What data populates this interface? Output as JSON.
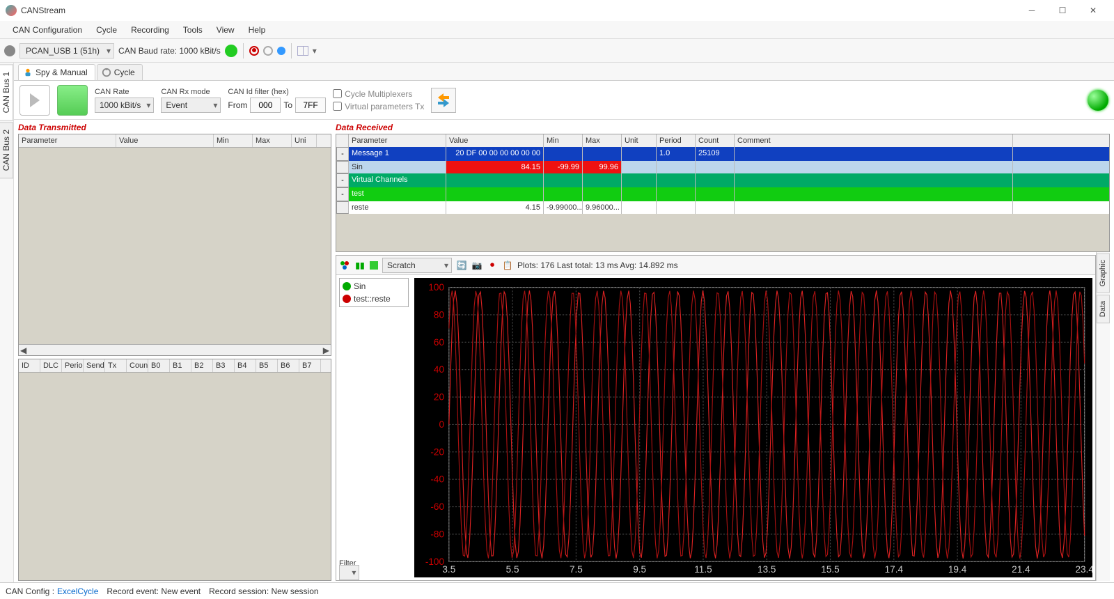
{
  "title": "CANStream",
  "menu": [
    "CAN Configuration",
    "Cycle",
    "Recording",
    "Tools",
    "View",
    "Help"
  ],
  "toolbar": {
    "device": "PCAN_USB 1 (51h)",
    "baud_label": "CAN Baud rate: 1000 kBit/s"
  },
  "vtabs": [
    "CAN Bus 1",
    "CAN Bus 2"
  ],
  "innertabs": {
    "spy": "Spy & Manual",
    "cycle": "Cycle"
  },
  "ctrl": {
    "can_rate_label": "CAN Rate",
    "can_rate": "1000 kBit/s",
    "rx_mode_label": "CAN Rx mode",
    "rx_mode": "Event",
    "id_filter_label": "CAN Id filter (hex)",
    "from_label": "From",
    "from": "000",
    "to_label": "To",
    "to": "7FF",
    "chk_mux": "Cycle Multiplexers",
    "chk_vtx": "Virtual parameters Tx"
  },
  "tx_label": "Data Transmitted",
  "tx_cols": [
    "Parameter",
    "Value",
    "Min",
    "Max",
    "Uni"
  ],
  "rx_label": "Data Received",
  "rx_cols": [
    "",
    "Parameter",
    "Value",
    "Min",
    "Max",
    "Unit",
    "Period",
    "Count",
    "Comment"
  ],
  "rx_rows": [
    {
      "cls": "blue",
      "toggle": "-",
      "cells": [
        "Message 1",
        "20 DF 00 00 00 00 00 00",
        "",
        "",
        "",
        "1.0",
        "25109",
        ""
      ]
    },
    {
      "cls": "ltblue",
      "toggle": "",
      "cells": [
        "Sin",
        "84.15",
        "-99.99",
        "99.96",
        "",
        "",
        "",
        ""
      ],
      "red": [
        1,
        2,
        3
      ]
    },
    {
      "cls": "green",
      "toggle": "-",
      "cells": [
        "Virtual Channels",
        "",
        "",
        "",
        "",
        "",
        "",
        ""
      ]
    },
    {
      "cls": "lgreen",
      "toggle": "-",
      "cells": [
        "test",
        "",
        "",
        "",
        "",
        "",
        "",
        ""
      ]
    },
    {
      "cls": "white",
      "toggle": "",
      "cells": [
        "reste",
        "4.15",
        "-9.99000...",
        "9.96000...",
        "",
        "",
        "",
        ""
      ]
    }
  ],
  "txgrid2_cols": [
    "ID",
    "DLC",
    "Perio",
    "Send",
    "Tx",
    "Coun",
    "B0",
    "B1",
    "B2",
    "B3",
    "B4",
    "B5",
    "B6",
    "B7"
  ],
  "graph": {
    "preset": "Scratch",
    "stats": "Plots: 176  Last total: 13 ms  Avg: 14.892 ms",
    "legend": [
      "Sin",
      "test::reste"
    ],
    "filter_label": "Filter",
    "rvtabs": [
      "Graphic",
      "Data"
    ],
    "yticks": [
      "100",
      "80",
      "60",
      "40",
      "20",
      "0",
      "-20",
      "-40",
      "-60",
      "-80",
      "-100"
    ],
    "xticks": [
      "3.5",
      "5.5",
      "7.5",
      "9.5",
      "11.5",
      "13.5",
      "15.5",
      "17.4",
      "19.4",
      "21.4",
      "23.4"
    ]
  },
  "chart_data": {
    "type": "line",
    "title": "",
    "xlabel": "",
    "ylabel": "",
    "xlim": [
      3.5,
      23.4
    ],
    "ylim": [
      -100,
      100
    ],
    "series": [
      {
        "name": "Sin",
        "color": "#c00"
      },
      {
        "name": "test::reste",
        "color": "#c00"
      }
    ],
    "note": "Two overlaid high-frequency sinusoidal traces oscillating approximately between -100 and 100 across x-range 3.5 to 23.4; exact per-point values not labeled."
  },
  "status": {
    "cfg_label": "CAN Config :",
    "cfg_name": "ExcelCycle",
    "rec_event": "Record event: New event",
    "rec_session": "Record session: New session"
  }
}
